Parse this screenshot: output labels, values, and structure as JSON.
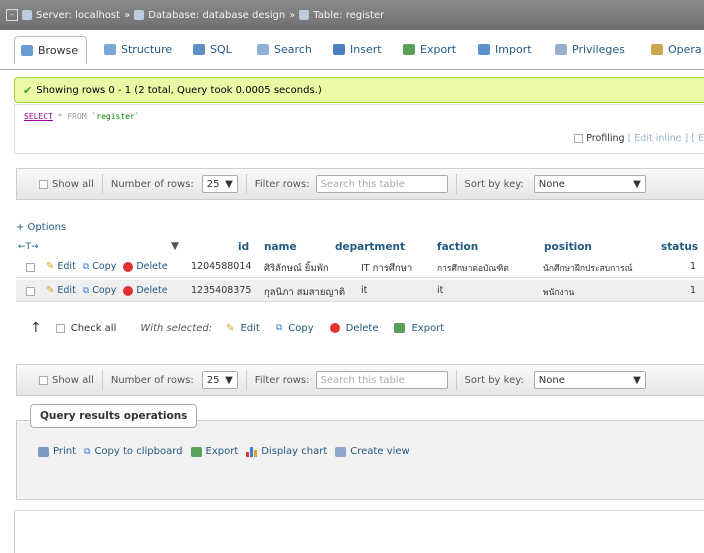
{
  "breadcrumb": {
    "server": "Server: localhost",
    "database": "Database: database design",
    "table": "Table: register"
  },
  "tabs": [
    {
      "label": "Browse",
      "color": "#6a9bd1"
    },
    {
      "label": "Structure",
      "color": "#7aa9d8"
    },
    {
      "label": "SQL",
      "color": "#5f8fc4"
    },
    {
      "label": "Search",
      "color": "#8fb1d8"
    },
    {
      "label": "Insert",
      "color": "#4a7fc4"
    },
    {
      "label": "Export",
      "color": "#5aa05a"
    },
    {
      "label": "Import",
      "color": "#5a8fd0"
    },
    {
      "label": "Privileges",
      "color": "#9ab0c8"
    },
    {
      "label": "Opera",
      "color": "#c9a74a"
    }
  ],
  "message": "Showing rows 0 - 1 (2 total, Query took 0.0005 seconds.)",
  "query": {
    "select": "SELECT",
    "rest": "* FROM",
    "table": "`register`"
  },
  "profiling": {
    "label": "Profiling",
    "edit_inline": "[ Edit inline ]",
    "edit": "[ E"
  },
  "nav": {
    "show_all": "Show all",
    "number_of_rows": "Number of rows:",
    "rows_value": "25",
    "filter_rows": "Filter rows:",
    "filter_placeholder": "Search this table",
    "sort_by_key": "Sort by key:",
    "sort_value": "None"
  },
  "options_label": "+ Options",
  "arrows": "←T→",
  "columns": [
    "id",
    "name",
    "department",
    "faction",
    "position",
    "status"
  ],
  "actions": {
    "edit": "Edit",
    "copy": "Copy",
    "delete": "Delete"
  },
  "rows": [
    {
      "id": "1204588014",
      "name": "ศิริลักษณ์ ยิ้มพัก",
      "department": "IT การศึกษา",
      "faction": "การศึกษาต่อบัณฑิต",
      "position": "นักศึกษาฝึกประสบการณ์",
      "status": "1"
    },
    {
      "id": "1235408375",
      "name": "กุลนิภา สมสายญาติ",
      "department": "it",
      "faction": "it",
      "position": "พนักงาน",
      "status": "1"
    }
  ],
  "multi": {
    "check_all": "Check all",
    "with_selected": "With selected:",
    "edit": "Edit",
    "copy": "Copy",
    "delete": "Delete",
    "export": "Export"
  },
  "qro": {
    "legend": "Query results operations",
    "print": "Print",
    "copy_clipboard": "Copy to clipboard",
    "export": "Export",
    "display_chart": "Display chart",
    "create_view": "Create view"
  }
}
